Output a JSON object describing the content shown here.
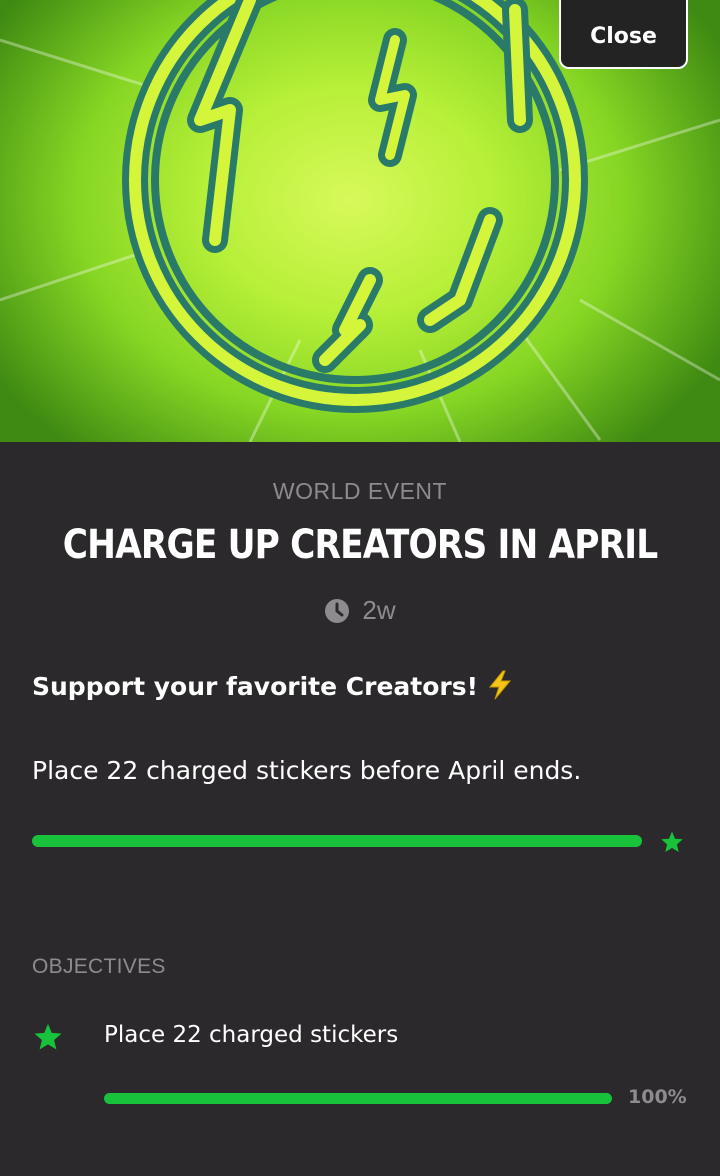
{
  "header": {
    "close_label": "Close"
  },
  "event": {
    "category": "WORLD EVENT",
    "title": "CHARGE UP CREATORS IN APRIL",
    "time_remaining": "2w",
    "time_icon": "clock-icon"
  },
  "challenge": {
    "headline": "Support your favorite Creators!",
    "headline_icon": "lightning-bolt-icon",
    "description": "Place 22 charged stickers before April ends.",
    "progress_fraction": 1.0,
    "complete_icon": "star-icon"
  },
  "objectives": {
    "header": "OBJECTIVES",
    "items": [
      {
        "label": "Place 22 charged stickers",
        "icon": "star-icon",
        "progress_fraction": 1.0,
        "percent_label": "100%"
      }
    ]
  },
  "colors": {
    "background": "#2b292b",
    "accent_green": "#18c23a",
    "muted_text": "#8e8a8e",
    "hero_lime": "#c8f53c",
    "hero_teal": "#2a7a6a"
  }
}
